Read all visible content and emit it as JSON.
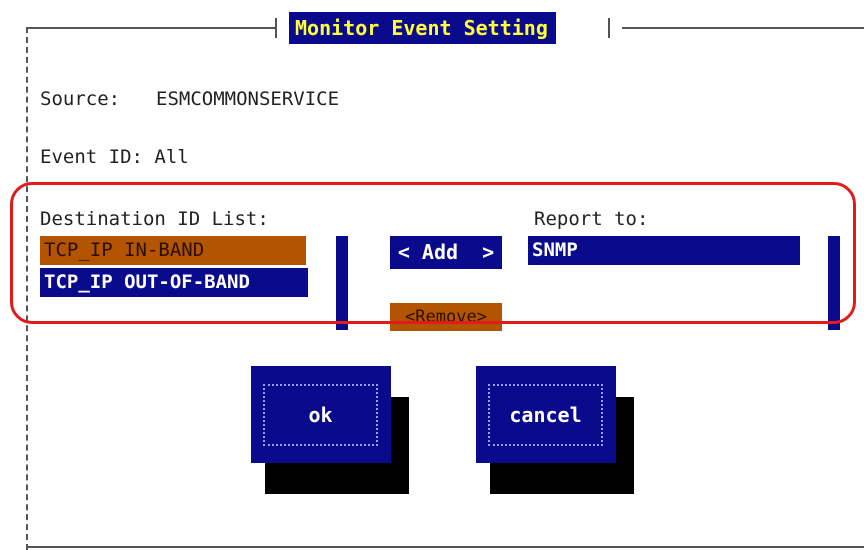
{
  "dialog": {
    "title": "Monitor Event Setting",
    "source_label": "Source:",
    "source_value": "ESMCOMMONSERVICE",
    "event_id_text": "Event ID: All"
  },
  "destination_list": {
    "header": "Destination ID List:",
    "items": [
      {
        "label": "TCP_IP IN-BAND",
        "state": "focused"
      },
      {
        "label": "TCP_IP OUT-OF-BAND",
        "state": "selected"
      }
    ]
  },
  "report_list": {
    "header": "Report to:",
    "items": [
      {
        "label": "SNMP",
        "state": "selected"
      }
    ]
  },
  "actions": {
    "add_label": "< Add  >",
    "remove_label": "<Remove>"
  },
  "buttons": {
    "ok_label": "ok",
    "cancel_label": "cancel"
  },
  "colors": {
    "dialog_blue": "#0a0a8c",
    "focus_orange": "#b25400",
    "title_yellow": "#ffff38",
    "highlight_red": "#e11b1b"
  }
}
